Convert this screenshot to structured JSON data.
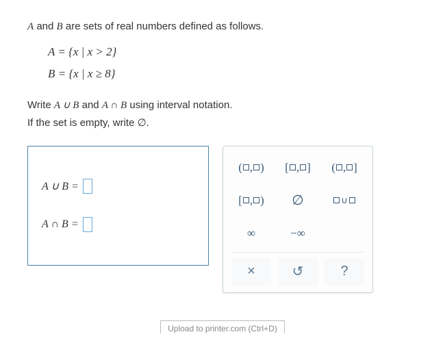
{
  "intro": {
    "prefix": "",
    "setA_name": "A",
    "and": " and ",
    "setB_name": "B",
    "suffix": " are sets of real numbers defined as follows."
  },
  "definitions": {
    "lineA": "A = {x | x > 2}",
    "lineB": "B = {x | x ≥ 8}"
  },
  "instructions": {
    "line1_pre": "Write ",
    "expr_union": "A ∪ B",
    "mid": " and ",
    "expr_inter": "A ∩ B",
    "line1_post": " using interval notation.",
    "line2": "If the set is empty, write ∅."
  },
  "answers": {
    "union_label": "A ∪ B =",
    "inter_label": "A ∩ B ="
  },
  "palette": {
    "r1c1": "(□,□)",
    "r1c2": "[□,□]",
    "r1c3": "(□,□]",
    "r2c1": "[□,□)",
    "r2c2": "∅",
    "r3c1": "∞",
    "r3c2": "−∞"
  },
  "tools": {
    "clear": "×",
    "reset": "↺",
    "help": "?"
  },
  "footer": "Upload to printer.com (Ctrl+D)"
}
